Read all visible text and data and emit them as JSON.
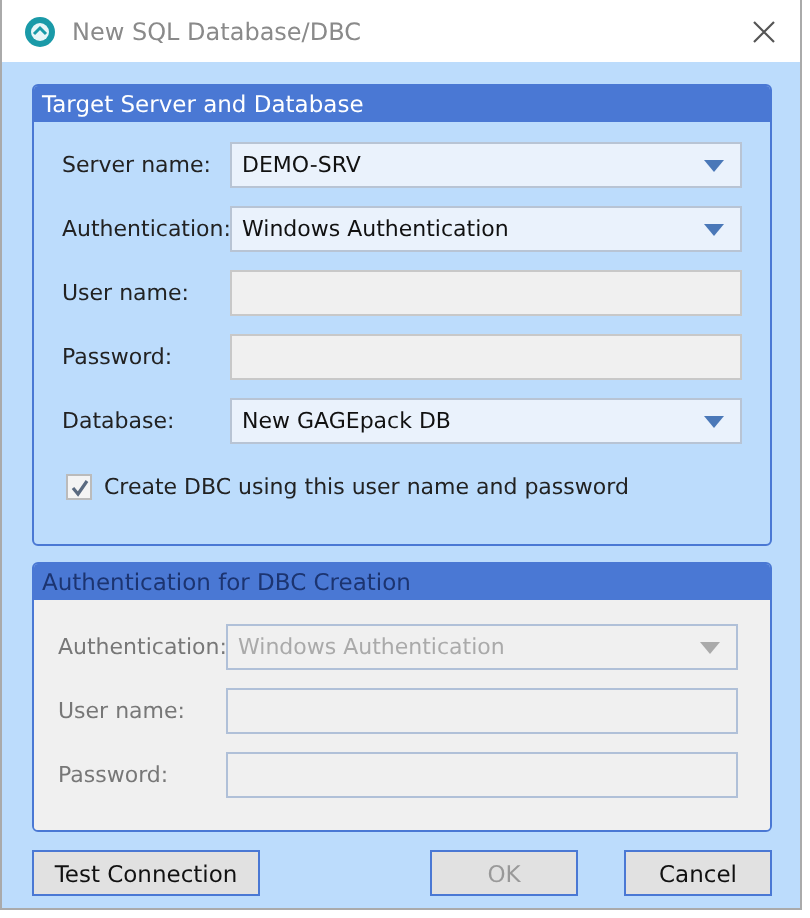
{
  "window": {
    "title": "New SQL Database/DBC"
  },
  "groups": [
    {
      "title": "Target Server and Database",
      "disabled": false,
      "fields": [
        {
          "kind": "dropdown",
          "label": "Server name:",
          "value": "DEMO-SRV"
        },
        {
          "kind": "dropdown",
          "label": "Authentication:",
          "value": "Windows Authentication"
        },
        {
          "kind": "text",
          "label": "User name:",
          "disabled": true
        },
        {
          "kind": "text",
          "label": "Password:",
          "disabled": true
        },
        {
          "kind": "dropdown",
          "label": "Database:",
          "value": "New GAGEpack DB"
        },
        {
          "kind": "checkbox",
          "label": "Create DBC using this user name and password",
          "checked": true
        }
      ]
    },
    {
      "title": "Authentication for DBC Creation",
      "disabled": true,
      "fields": [
        {
          "kind": "dropdown",
          "label": "Authentication:",
          "value": "Windows Authentication"
        },
        {
          "kind": "text",
          "label": "User name:",
          "disabled": true
        },
        {
          "kind": "text",
          "label": "Password:",
          "disabled": true
        }
      ]
    }
  ],
  "buttons": [
    {
      "label": "Test Connection",
      "disabled": false
    },
    {
      "label": "OK",
      "disabled": true
    },
    {
      "label": "Cancel",
      "disabled": false
    }
  ]
}
